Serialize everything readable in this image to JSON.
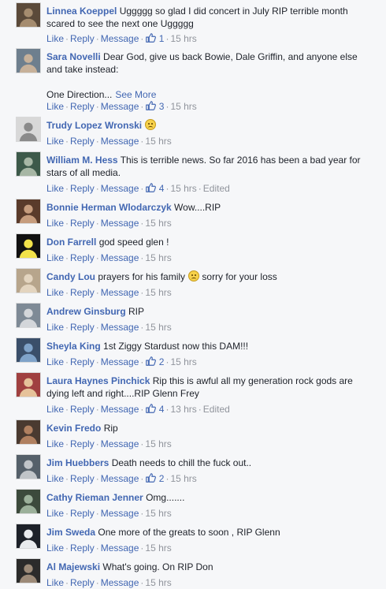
{
  "actions": {
    "like": "Like",
    "reply": "Reply",
    "message": "Message",
    "dot": "·"
  },
  "like_icon": "thumbs-up-icon",
  "colors": {
    "link": "#4267b2",
    "meta": "#90949c",
    "text": "#1d2129",
    "background": "#f6f7f9"
  },
  "comments": [
    {
      "author": "Linnea Koeppel",
      "text": "Uggggg so glad I did concert in July RIP terrible month scared to see the next one Uggggg",
      "likes": "1",
      "time": "15 hrs",
      "edited": ""
    },
    {
      "author": "Sara Novelli",
      "text": "Dear God, give us back Bowie, Dale Griffin, and anyone else and take instead:\n\nOne Direction...",
      "see_more": "See More",
      "likes": "3",
      "time": "15 hrs",
      "edited": ""
    },
    {
      "author": "Trudy Lopez Wronski",
      "text": "",
      "emoji": "frown-emoji-icon",
      "likes": "",
      "time": "15 hrs",
      "edited": ""
    },
    {
      "author": "William M. Hess",
      "text": "This is terrible news. So far 2016 has been a bad year for stars of all media.",
      "likes": "4",
      "time": "15 hrs",
      "edited": "Edited"
    },
    {
      "author": "Bonnie Herman Wlodarczyk",
      "text": "Wow....RIP",
      "likes": "",
      "time": "15 hrs",
      "edited": ""
    },
    {
      "author": "Don Farrell",
      "text": "god speed glen !",
      "likes": "",
      "time": "15 hrs",
      "edited": ""
    },
    {
      "author": "Candy Lou",
      "text": "prayers for his family",
      "emoji": "frown-emoji-icon",
      "text_after": "sorry for your loss",
      "likes": "",
      "time": "15 hrs",
      "edited": ""
    },
    {
      "author": "Andrew Ginsburg",
      "text": "RIP",
      "likes": "",
      "time": "15 hrs",
      "edited": ""
    },
    {
      "author": "Sheyla King",
      "text": "1st Ziggy Stardust now this DAM!!!",
      "likes": "2",
      "time": "15 hrs",
      "edited": ""
    },
    {
      "author": "Laura Haynes Pinchick",
      "text": "Rip this is awful all my generation rock gods are dying left and right....RIP Glenn Frey",
      "likes": "4",
      "time": "13 hrs",
      "edited": "Edited"
    },
    {
      "author": "Kevin Fredo",
      "text": "Rip",
      "likes": "",
      "time": "15 hrs",
      "edited": ""
    },
    {
      "author": "Jim Huebbers",
      "text": "Death needs to chill the fuck out..",
      "likes": "2",
      "time": "15 hrs",
      "edited": ""
    },
    {
      "author": "Cathy Rieman Jenner",
      "text": "Omg.......",
      "likes": "",
      "time": "15 hrs",
      "edited": ""
    },
    {
      "author": "Jim Sweda",
      "text": "One more of the greats to soon , RIP Glenn",
      "likes": "",
      "time": "15 hrs",
      "edited": ""
    },
    {
      "author": "Al Majewski",
      "text": "What's going. On RIP Don",
      "likes": "",
      "time": "15 hrs",
      "edited": ""
    }
  ]
}
